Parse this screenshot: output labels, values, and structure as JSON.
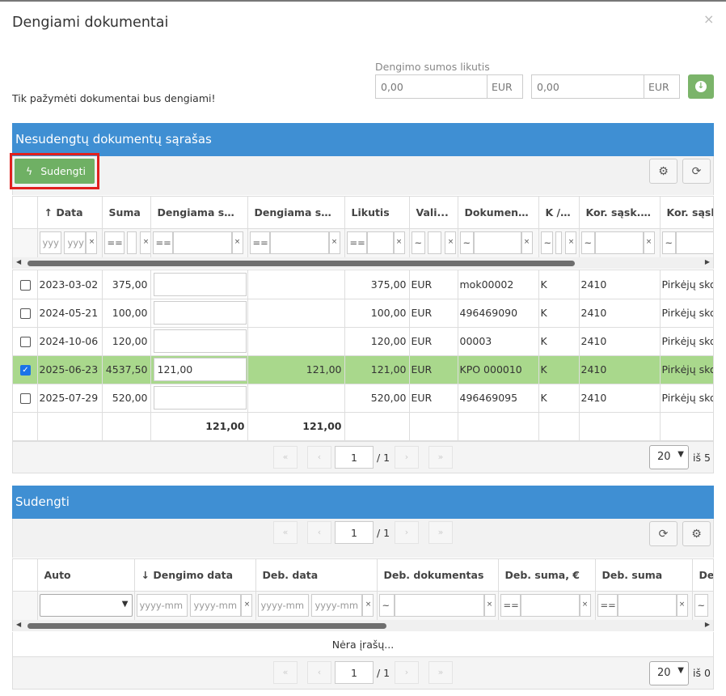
{
  "dialog": {
    "title": "Dengiami dokumentai",
    "close_glyph": "×",
    "note": "Tik pažymėti dokumentai bus dengiami!",
    "remaining_label": "Dengimo sumos likutis",
    "amount1": "0,00",
    "amount2": "0,00",
    "currency": "EUR"
  },
  "top": {
    "header": "Nesudengtų dokumentų sąrašas",
    "offset_button": "Sudengti",
    "columns": [
      "Data",
      "Suma",
      "Dengiama su...",
      "Dengiama su...",
      "Likutis",
      "Vali...",
      "Dokument...",
      "K / D",
      "Kor. sąsk. ...",
      "Kor. sąsk"
    ],
    "sort_arrow": "↑",
    "filters": {
      "date_from": "yyy",
      "date_to": "yyy",
      "eq": "==",
      "like": "~",
      "clear": "×"
    },
    "rows": [
      {
        "date": "2023-03-02",
        "sum": "375,00",
        "pay1": "",
        "pay2": "",
        "remaining": "375,00",
        "currency": "EUR",
        "doc": "mok00002",
        "kd": "K",
        "account": "2410",
        "account_name": "Pirkėjų sko"
      },
      {
        "date": "2024-05-21",
        "sum": "100,00",
        "pay1": "",
        "pay2": "",
        "remaining": "100,00",
        "currency": "EUR",
        "doc": "496469090",
        "kd": "K",
        "account": "2410",
        "account_name": "Pirkėjų sko"
      },
      {
        "date": "2024-10-06",
        "sum": "120,00",
        "pay1": "",
        "pay2": "",
        "remaining": "120,00",
        "currency": "EUR",
        "doc": "00003",
        "kd": "K",
        "account": "2410",
        "account_name": "Pirkėjų sko"
      },
      {
        "date": "2025-06-23",
        "sum": "4537,50",
        "pay1": "121,00",
        "pay2": "121,00",
        "remaining": "121,00",
        "currency": "EUR",
        "doc": "KPO 000010",
        "kd": "K",
        "account": "2410",
        "account_name": "Pirkėjų sko",
        "selected": true
      },
      {
        "date": "2025-07-29",
        "sum": "520,00",
        "pay1": "",
        "pay2": "",
        "remaining": "520,00",
        "currency": "EUR",
        "doc": "496469095",
        "kd": "K",
        "account": "2410",
        "account_name": "Pirkėjų sko"
      }
    ],
    "totals": {
      "pay1": "121,00",
      "pay2": "121,00"
    },
    "pager": {
      "page": "1",
      "of": "/ 1",
      "size": "20",
      "count": "iš 5"
    }
  },
  "bottom": {
    "header": "Sudengti",
    "columns": [
      "Auto",
      "Dengimo data",
      "Deb. data",
      "Deb. dokumentas",
      "Deb. suma, €",
      "Deb. suma",
      "De"
    ],
    "sort_arrow": "↓",
    "filters": {
      "date_from": "yyyy-mm",
      "date_to": "yyyy-mm"
    },
    "empty": "Nėra įrašų...",
    "pager": {
      "page": "1",
      "of": "/ 1",
      "size": "20",
      "count": "iš 0"
    }
  },
  "icons": {
    "gear": "gear-icon",
    "refresh": "refresh-icon",
    "download": "download-icon",
    "bolt": "bolt-icon"
  }
}
